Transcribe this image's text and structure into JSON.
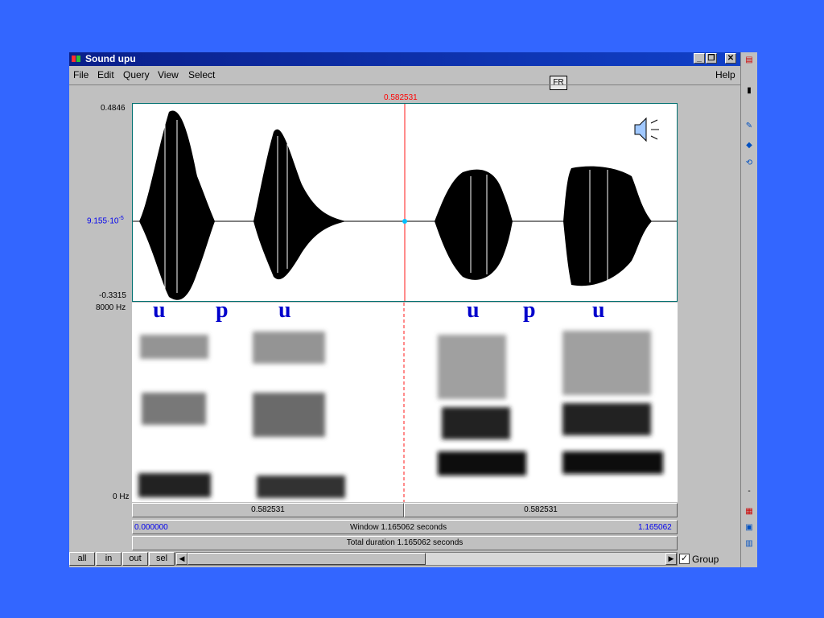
{
  "window": {
    "title": "Sound upu",
    "controls": {
      "minimize": "_",
      "restore": "❐",
      "close": "✕"
    }
  },
  "menu": {
    "items": [
      "File",
      "Edit",
      "Query",
      "View",
      "Select"
    ],
    "help": "Help"
  },
  "cursor_time": "0.582531",
  "waveform": {
    "y_max": "0.4846",
    "y_mid": "9.155·10",
    "y_mid_exp": "-5",
    "y_min": "-0.3315"
  },
  "spectrogram": {
    "f_max": "8000 Hz",
    "f_min": "0 Hz",
    "phonemes": [
      "u",
      "p",
      "u",
      "u",
      "p",
      "u"
    ]
  },
  "selection": {
    "left": "0.582531",
    "right": "0.582531"
  },
  "window_info": {
    "start": "0.000000",
    "label": "Window 1.165062 seconds",
    "end": "1.165062"
  },
  "total": {
    "label": "Total duration 1.165062 seconds"
  },
  "buttons": {
    "all": "all",
    "in": "in",
    "out": "out",
    "sel": "sel"
  },
  "group": {
    "label": "Group",
    "checked": true
  },
  "colors": {
    "desktop": "#3366ff",
    "cursor": "#ff0000",
    "axis_blue": "#0000ee",
    "phoneme": "#0000cc"
  }
}
